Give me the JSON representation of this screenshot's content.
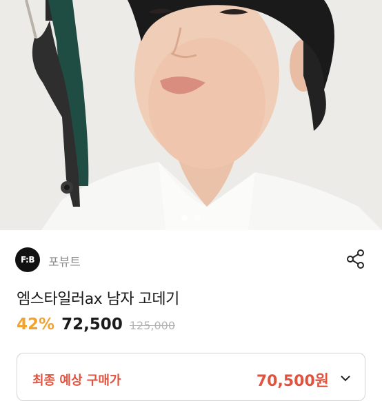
{
  "hero": {
    "slide_count": 2,
    "active_slide": 1
  },
  "brand": {
    "logo_text": "F:B",
    "name": "포뷰트"
  },
  "product": {
    "title": "엠스타일러ax 남자 고데기",
    "discount": "42%",
    "price": "72,500",
    "original_price": "125,000"
  },
  "final": {
    "label": "최종 예상 구매가",
    "price": "70,500원"
  },
  "colors": {
    "accent": "#f0a32f",
    "final_red": "#e0533f",
    "device_green": "#1f4d43"
  },
  "icons": {
    "share": "share-icon",
    "expand": "chevron-down-icon"
  }
}
